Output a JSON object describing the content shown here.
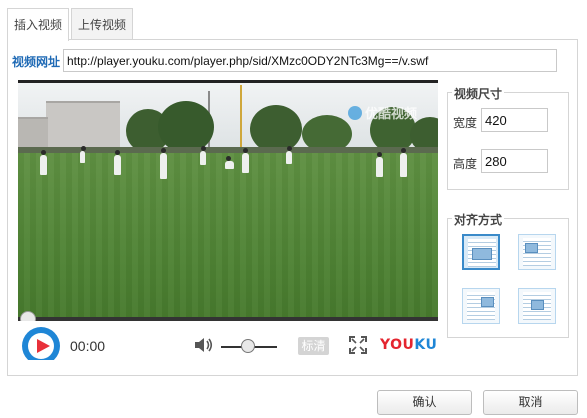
{
  "tabs": [
    {
      "label": "插入视频",
      "active": true
    },
    {
      "label": "上传视频",
      "active": false
    }
  ],
  "url": {
    "label": "视频网址",
    "value": "http://player.youku.com/player.php/sid/XMzc0ODY2NTc3Mg==/v.swf"
  },
  "player": {
    "time": "00:00",
    "quality_label": "标清",
    "brand": {
      "you": "YOU",
      "ku": "KU"
    },
    "watermark": "优酷视频",
    "progress": 0,
    "volume": 0.5,
    "icons": [
      "play-icon",
      "volume-icon",
      "fullscreen-icon"
    ]
  },
  "size": {
    "legend": "视频尺寸",
    "width_label": "宽度",
    "width_value": "420",
    "height_label": "高度",
    "height_value": "280"
  },
  "align": {
    "legend": "对齐方式",
    "options": [
      {
        "name": "align-none",
        "active": true
      },
      {
        "name": "align-left",
        "active": false
      },
      {
        "name": "align-right",
        "active": false
      },
      {
        "name": "align-center",
        "active": false
      }
    ]
  },
  "buttons": {
    "ok": "确认",
    "cancel": "取消"
  },
  "colors": {
    "accent": "#1f86d6",
    "label_blue": "#1f6ab5",
    "youku_red": "#e4252f"
  }
}
